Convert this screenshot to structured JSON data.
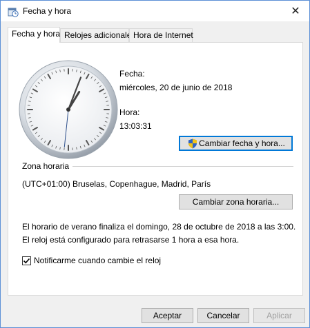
{
  "window": {
    "title": "Fecha y hora",
    "close_glyph": "✕"
  },
  "tabs": [
    {
      "label": "Fecha y hora",
      "active": true
    },
    {
      "label": "Relojes adicionales",
      "active": false
    },
    {
      "label": "Hora de Internet",
      "active": false
    }
  ],
  "datetime": {
    "date_label": "Fecha:",
    "date_value": "miércoles, 20 de junio de 2018",
    "time_label": "Hora:",
    "time_value": "13:03:31",
    "change_button": "Cambiar fecha y hora..."
  },
  "timezone": {
    "group_label": "Zona horaria",
    "value": "(UTC+01:00) Bruselas, Copenhague, Madrid, París",
    "change_button": "Cambiar zona horaria..."
  },
  "dst_notice": "El horario de verano finaliza el domingo, 28 de octubre de 2018 a las 3:00. El reloj está configurado para retrasarse 1 hora a esa hora.",
  "notify": {
    "label": "Notificarme cuando cambie el reloj",
    "checked": true
  },
  "footer": {
    "accept": "Aceptar",
    "cancel": "Cancelar",
    "apply": "Aplicar"
  },
  "icons": {
    "title": "clock-calendar-icon",
    "shield": "uac-shield-icon",
    "close": "close-icon"
  }
}
